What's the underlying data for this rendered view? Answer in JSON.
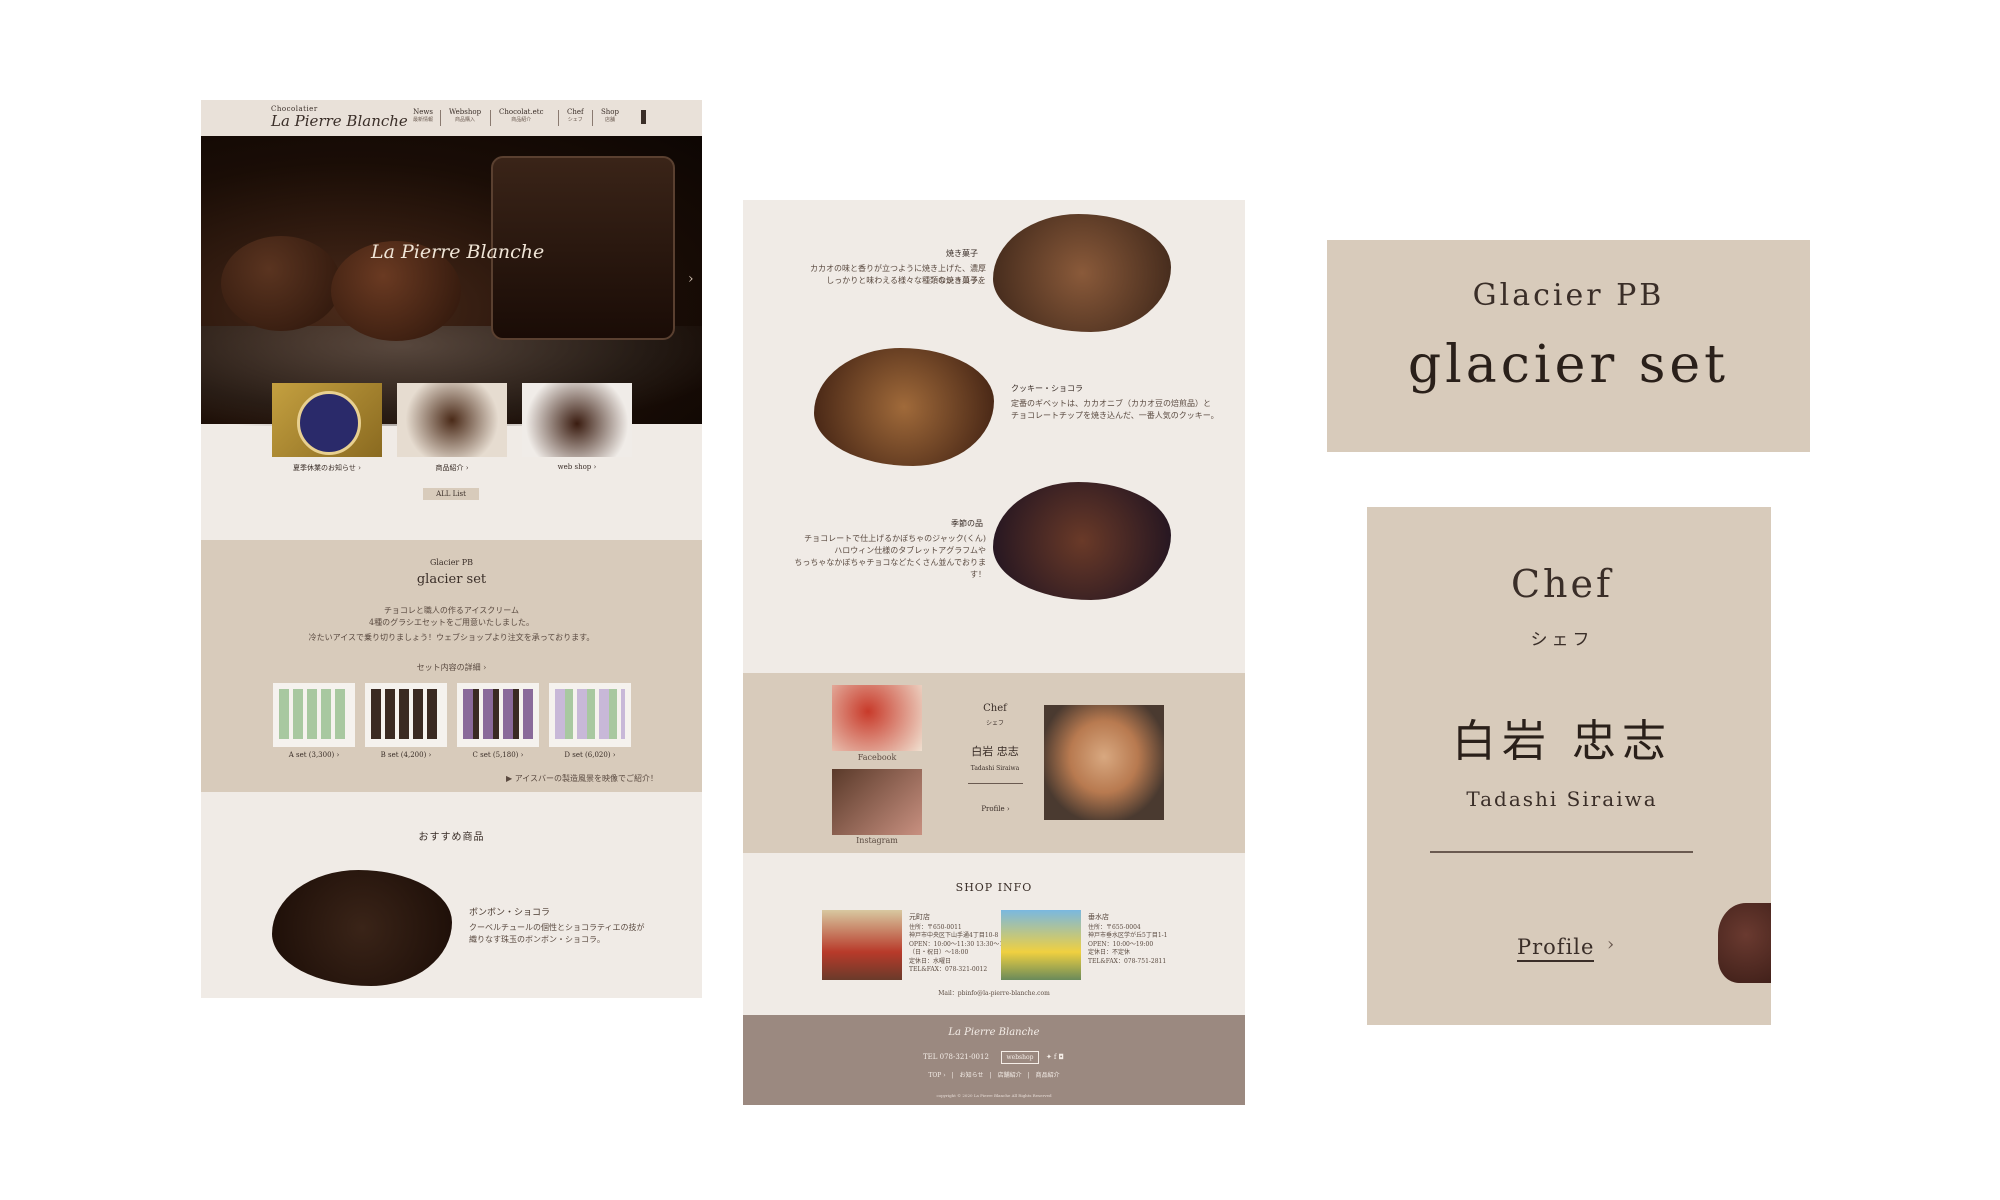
{
  "panel1": {
    "header": {
      "logo_top": "Chocolatier",
      "logo": "La Pierre Blanche",
      "nav": [
        {
          "label": "News",
          "sub": "最新情報"
        },
        {
          "label": "Webshop",
          "sub": "商品購入"
        },
        {
          "label": "Chocolat.etc",
          "sub": "商品紹介"
        },
        {
          "label": "Chef",
          "sub": "シェフ"
        },
        {
          "label": "Shop",
          "sub": "店舗"
        }
      ]
    },
    "hero_title": "La Pierre Blanche",
    "hero_arrow": "›",
    "thumbs": [
      {
        "label": "夏季休業のお知らせ ›"
      },
      {
        "label": "商品紹介 ›"
      },
      {
        "label": "web shop ›"
      }
    ],
    "all_list": "ALL List",
    "glacier": {
      "sub": "Glacier PB",
      "title": "glacier set",
      "desc1": "チョコレと職人の作るアイスクリーム",
      "desc2": "4種のグラシエセットをご用意いたしました。",
      "desc3": "冷たいアイスで乗り切りましょう！ウェブショップより注文を承っております。",
      "detail_link": "セット内容の詳細 ›",
      "sets": [
        {
          "label": "A set (3,300) ›"
        },
        {
          "label": "B set (4,200) ›"
        },
        {
          "label": "C set (5,180) ›"
        },
        {
          "label": "D set (6,020) ›"
        }
      ],
      "video_link": "▶ アイスバーの製造風景を映像でご紹介！"
    },
    "recommend": {
      "title": "おすすめ商品",
      "item_title": "ボンボン・ショコラ",
      "item_desc1": "クーベルチュールの個性とショコラティエの技が",
      "item_desc2": "織りなす珠玉のボンボン・ショコラ。"
    }
  },
  "panel2": {
    "items": [
      {
        "title": "焼き菓子",
        "desc1": "カカオの味と香りが立つように焼き上げた、濃厚なショコラを",
        "desc2": "しっかりと味わえる様々な種類の焼き菓子。"
      },
      {
        "title": "クッキー・ショコラ",
        "desc1": "定番のギベットは、カカオニブ（カカオ豆の焙煎品）と",
        "desc2": "チョコレートチップを焼き込んだ、一番人気のクッキー。"
      },
      {
        "title": "季節の品",
        "desc1": "チョコレートで仕上げるかぼちゃのジャック(くん)",
        "desc2": "ハロウィン仕様のタブレットアグラフムや",
        "desc3": "ちっちゃなかぼちゃチョコなどたくさん並んでおります！"
      }
    ],
    "chef": {
      "title": "Chef",
      "sub": "シェフ",
      "name": "白岩 忠志",
      "roman": "Tadashi Siraiwa",
      "profile": "Profile ›",
      "facebook": "Facebook",
      "instagram": "Instagram"
    },
    "shop": {
      "title": "SHOP INFO",
      "shops": [
        {
          "name": "元町店",
          "l1": "住所：〒650-0011",
          "l2": "神戸市中央区下山手通4丁目10-8",
          "l3": "OPEN：10:00〜11:30 13:30〜18:30",
          "l4": "（日・祝日）〜18:00",
          "l5": "定休日：水曜日",
          "tel": "TEL&FAX：078-321-0012"
        },
        {
          "name": "垂水店",
          "l1": "住所：〒655-0004",
          "l2": "神戸市垂水区学が丘5丁目1-1",
          "l3": "OPEN：10:00〜19:00",
          "l4": "",
          "l5": "定休日：不定休",
          "tel": "TEL&FAX：078-751-2811"
        }
      ],
      "mail": "Mail：pbinfo@la-pierre-blanche.com"
    },
    "footer": {
      "logo": "La Pierre Blanche",
      "tel": "TEL 078-321-0012",
      "webshop": "webshop",
      "links": "TOP ›　|　お知らせ　|　店舗紹介　|　商品紹介",
      "copyright": "copyright © 2020 La Pierre Blanche All Rights Reserved"
    }
  },
  "panel3": {
    "sub": "Glacier PB",
    "title": "glacier set"
  },
  "panel4": {
    "title": "Chef",
    "sub": "シェフ",
    "name": "白岩 忠志",
    "roman": "Tadashi Siraiwa",
    "profile": "Profile",
    "profile_arrow": "›"
  }
}
